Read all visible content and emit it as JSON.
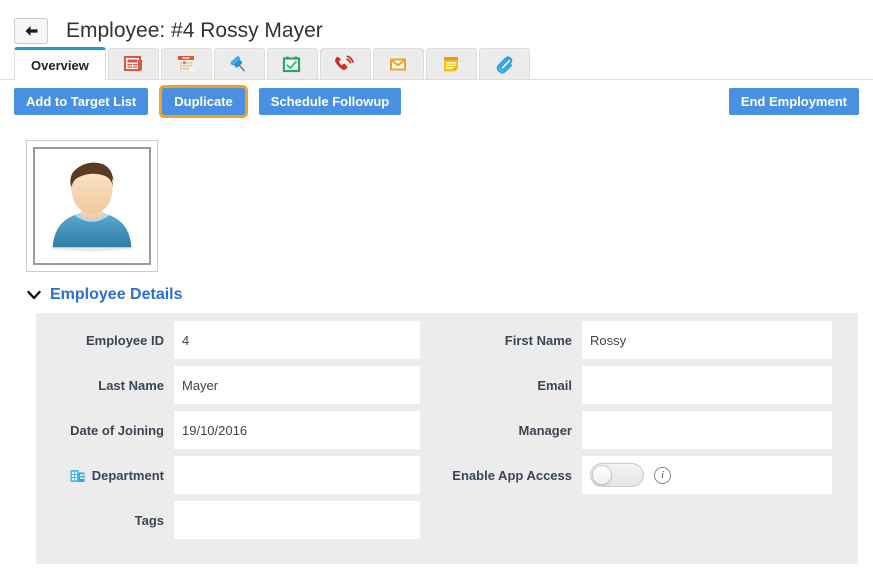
{
  "header": {
    "back_icon": "back-arrow-icon",
    "title": "Employee: #4 Rossy Mayer"
  },
  "tabs": [
    {
      "label": "Overview",
      "icon": "",
      "active": true
    },
    {
      "label": "",
      "icon": "news-icon",
      "active": false
    },
    {
      "label": "",
      "icon": "calendar-red-icon",
      "active": false
    },
    {
      "label": "",
      "icon": "pin-icon",
      "active": false
    },
    {
      "label": "",
      "icon": "calendar-check-green-icon",
      "active": false
    },
    {
      "label": "",
      "icon": "phone-ringing-icon",
      "active": false
    },
    {
      "label": "",
      "icon": "envelope-icon",
      "active": false
    },
    {
      "label": "",
      "icon": "note-icon",
      "active": false
    },
    {
      "label": "",
      "icon": "paperclip-icon",
      "active": false
    }
  ],
  "actions": {
    "add_to_target_list": "Add to Target List",
    "duplicate": "Duplicate",
    "schedule_followup": "Schedule Followup",
    "end_employment": "End Employment",
    "highlight_color": "#f5a11e",
    "button_color": "#4a90e2"
  },
  "avatar": {
    "name": "employee-avatar",
    "hair_color": "#5a3a22",
    "skin_color": "#f6d6b4",
    "shirt_color": "#3f8fbf",
    "collar_color": "#9fd4ef"
  },
  "section": {
    "title": "Employee Details",
    "chevron_icon": "chevron-down-icon",
    "title_color": "#2a6ed8"
  },
  "form": {
    "left": [
      {
        "label": "Employee ID",
        "value": "4",
        "placeholder": "",
        "icon": ""
      },
      {
        "label": "Last Name",
        "value": "Mayer",
        "placeholder": "",
        "icon": ""
      },
      {
        "label": "Date of Joining",
        "value": "19/10/2016",
        "placeholder": "",
        "icon": ""
      },
      {
        "label": "Department",
        "value": "",
        "placeholder": "",
        "icon": "building-icon"
      },
      {
        "label": "Tags",
        "value": "",
        "placeholder": "",
        "icon": ""
      }
    ],
    "right": [
      {
        "label": "First Name",
        "value": "Rossy",
        "placeholder": "",
        "icon": ""
      },
      {
        "label": "Email",
        "value": "",
        "placeholder": "",
        "icon": ""
      },
      {
        "label": "Manager",
        "value": "",
        "placeholder": "",
        "icon": ""
      },
      {
        "label": "Enable App Access",
        "value": "",
        "placeholder": "",
        "icon": "",
        "type": "toggle",
        "toggle_state": "off",
        "info_icon": "info-icon"
      }
    ]
  }
}
